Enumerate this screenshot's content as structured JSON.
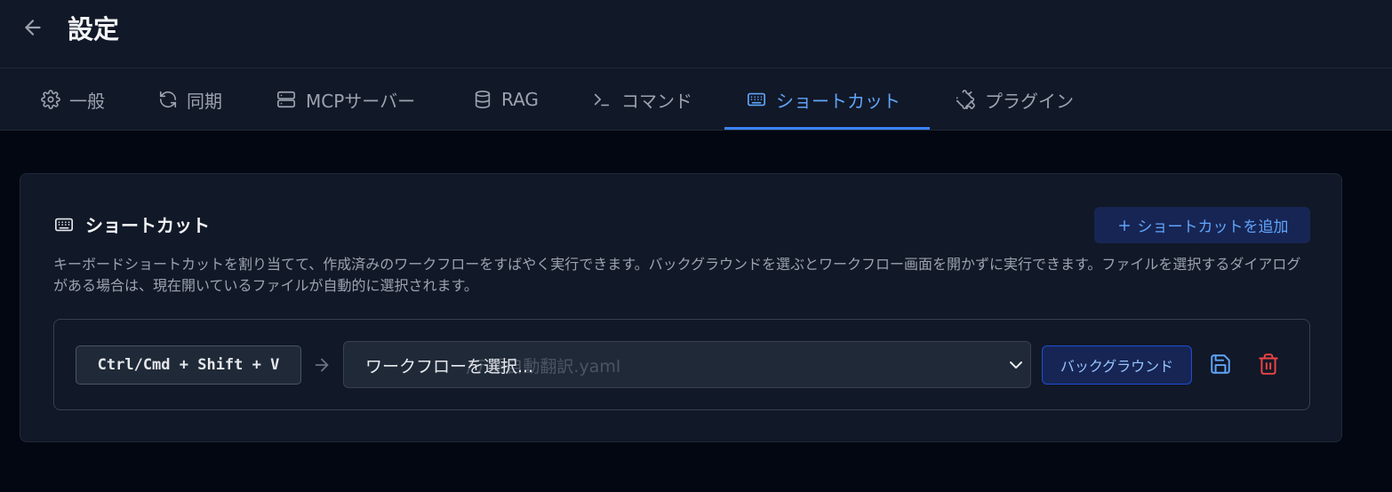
{
  "header": {
    "title": "設定"
  },
  "tabs": [
    {
      "label": "一般",
      "icon": "gear-icon"
    },
    {
      "label": "同期",
      "icon": "sync-icon"
    },
    {
      "label": "MCPサーバー",
      "icon": "server-icon"
    },
    {
      "label": "RAG",
      "icon": "database-icon"
    },
    {
      "label": "コマンド",
      "icon": "terminal-icon"
    },
    {
      "label": "ショートカット",
      "icon": "keyboard-icon",
      "active": true
    },
    {
      "label": "プラグイン",
      "icon": "puzzle-icon"
    }
  ],
  "shortcuts_section": {
    "title": "ショートカット",
    "add_button_label": "ショートカットを追加",
    "description": "キーボードショートカットを割り当てて、作成済みのワークフローをすばやく実行できます。バックグラウンドを選ぶとワークフロー画面を開かずに実行できます。ファイルを選択するダイアログがある場合は、現在開いているファイルが自動的に選択されます。",
    "rows": [
      {
        "key_combo": "Ctrl/Cmd + Shift + V",
        "workflow_ghost_text": "ワークフロー/テ語自動翻訳.yaml",
        "workflow_value": "ワークフローを選択...",
        "background_label": "バックグラウンド"
      }
    ]
  },
  "colors": {
    "accent": "#3b82f6",
    "accent_text": "#60a5fa",
    "delete": "#ef4444",
    "background": "#030712",
    "surface": "#111827"
  }
}
